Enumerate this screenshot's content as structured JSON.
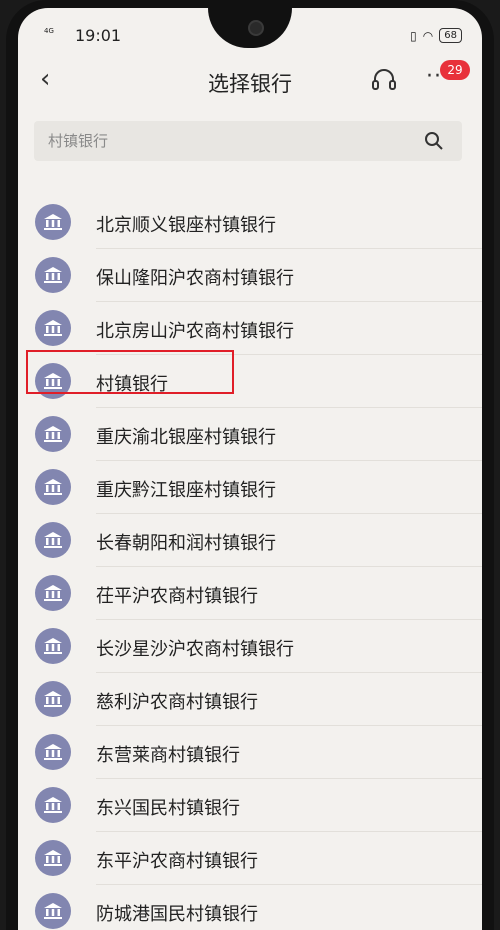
{
  "status": {
    "signal": "4G",
    "time": "19:01",
    "battery": "68"
  },
  "header": {
    "back_icon": "‹",
    "title": "选择银行",
    "more_icon": "···",
    "badge": "29"
  },
  "search": {
    "value": "村镇银行"
  },
  "banks": [
    "北京顺义银座村镇银行",
    "保山隆阳沪农商村镇银行",
    "北京房山沪农商村镇银行",
    "村镇银行",
    "重庆渝北银座村镇银行",
    "重庆黔江银座村镇银行",
    "长春朝阳和润村镇银行",
    "茌平沪农商村镇银行",
    "长沙星沙沪农商村镇银行",
    "慈利沪农商村镇银行",
    "东营莱商村镇银行",
    "东兴国民村镇银行",
    "东平沪农商村镇银行",
    "防城港国民村镇银行"
  ],
  "colors": {
    "highlight": "#e01e28",
    "bank_icon": "#8286b0",
    "badge": "#e8313a"
  }
}
